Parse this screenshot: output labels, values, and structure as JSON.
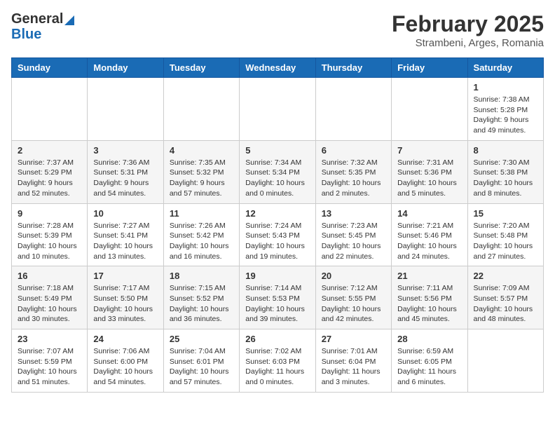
{
  "header": {
    "logo_general": "General",
    "logo_blue": "Blue",
    "month": "February 2025",
    "location": "Strambeni, Arges, Romania"
  },
  "days_of_week": [
    "Sunday",
    "Monday",
    "Tuesday",
    "Wednesday",
    "Thursday",
    "Friday",
    "Saturday"
  ],
  "weeks": [
    [
      {
        "day": "",
        "info": ""
      },
      {
        "day": "",
        "info": ""
      },
      {
        "day": "",
        "info": ""
      },
      {
        "day": "",
        "info": ""
      },
      {
        "day": "",
        "info": ""
      },
      {
        "day": "",
        "info": ""
      },
      {
        "day": "1",
        "info": "Sunrise: 7:38 AM\nSunset: 5:28 PM\nDaylight: 9 hours and 49 minutes."
      }
    ],
    [
      {
        "day": "2",
        "info": "Sunrise: 7:37 AM\nSunset: 5:29 PM\nDaylight: 9 hours and 52 minutes."
      },
      {
        "day": "3",
        "info": "Sunrise: 7:36 AM\nSunset: 5:31 PM\nDaylight: 9 hours and 54 minutes."
      },
      {
        "day": "4",
        "info": "Sunrise: 7:35 AM\nSunset: 5:32 PM\nDaylight: 9 hours and 57 minutes."
      },
      {
        "day": "5",
        "info": "Sunrise: 7:34 AM\nSunset: 5:34 PM\nDaylight: 10 hours and 0 minutes."
      },
      {
        "day": "6",
        "info": "Sunrise: 7:32 AM\nSunset: 5:35 PM\nDaylight: 10 hours and 2 minutes."
      },
      {
        "day": "7",
        "info": "Sunrise: 7:31 AM\nSunset: 5:36 PM\nDaylight: 10 hours and 5 minutes."
      },
      {
        "day": "8",
        "info": "Sunrise: 7:30 AM\nSunset: 5:38 PM\nDaylight: 10 hours and 8 minutes."
      }
    ],
    [
      {
        "day": "9",
        "info": "Sunrise: 7:28 AM\nSunset: 5:39 PM\nDaylight: 10 hours and 10 minutes."
      },
      {
        "day": "10",
        "info": "Sunrise: 7:27 AM\nSunset: 5:41 PM\nDaylight: 10 hours and 13 minutes."
      },
      {
        "day": "11",
        "info": "Sunrise: 7:26 AM\nSunset: 5:42 PM\nDaylight: 10 hours and 16 minutes."
      },
      {
        "day": "12",
        "info": "Sunrise: 7:24 AM\nSunset: 5:43 PM\nDaylight: 10 hours and 19 minutes."
      },
      {
        "day": "13",
        "info": "Sunrise: 7:23 AM\nSunset: 5:45 PM\nDaylight: 10 hours and 22 minutes."
      },
      {
        "day": "14",
        "info": "Sunrise: 7:21 AM\nSunset: 5:46 PM\nDaylight: 10 hours and 24 minutes."
      },
      {
        "day": "15",
        "info": "Sunrise: 7:20 AM\nSunset: 5:48 PM\nDaylight: 10 hours and 27 minutes."
      }
    ],
    [
      {
        "day": "16",
        "info": "Sunrise: 7:18 AM\nSunset: 5:49 PM\nDaylight: 10 hours and 30 minutes."
      },
      {
        "day": "17",
        "info": "Sunrise: 7:17 AM\nSunset: 5:50 PM\nDaylight: 10 hours and 33 minutes."
      },
      {
        "day": "18",
        "info": "Sunrise: 7:15 AM\nSunset: 5:52 PM\nDaylight: 10 hours and 36 minutes."
      },
      {
        "day": "19",
        "info": "Sunrise: 7:14 AM\nSunset: 5:53 PM\nDaylight: 10 hours and 39 minutes."
      },
      {
        "day": "20",
        "info": "Sunrise: 7:12 AM\nSunset: 5:55 PM\nDaylight: 10 hours and 42 minutes."
      },
      {
        "day": "21",
        "info": "Sunrise: 7:11 AM\nSunset: 5:56 PM\nDaylight: 10 hours and 45 minutes."
      },
      {
        "day": "22",
        "info": "Sunrise: 7:09 AM\nSunset: 5:57 PM\nDaylight: 10 hours and 48 minutes."
      }
    ],
    [
      {
        "day": "23",
        "info": "Sunrise: 7:07 AM\nSunset: 5:59 PM\nDaylight: 10 hours and 51 minutes."
      },
      {
        "day": "24",
        "info": "Sunrise: 7:06 AM\nSunset: 6:00 PM\nDaylight: 10 hours and 54 minutes."
      },
      {
        "day": "25",
        "info": "Sunrise: 7:04 AM\nSunset: 6:01 PM\nDaylight: 10 hours and 57 minutes."
      },
      {
        "day": "26",
        "info": "Sunrise: 7:02 AM\nSunset: 6:03 PM\nDaylight: 11 hours and 0 minutes."
      },
      {
        "day": "27",
        "info": "Sunrise: 7:01 AM\nSunset: 6:04 PM\nDaylight: 11 hours and 3 minutes."
      },
      {
        "day": "28",
        "info": "Sunrise: 6:59 AM\nSunset: 6:05 PM\nDaylight: 11 hours and 6 minutes."
      },
      {
        "day": "",
        "info": ""
      }
    ]
  ]
}
